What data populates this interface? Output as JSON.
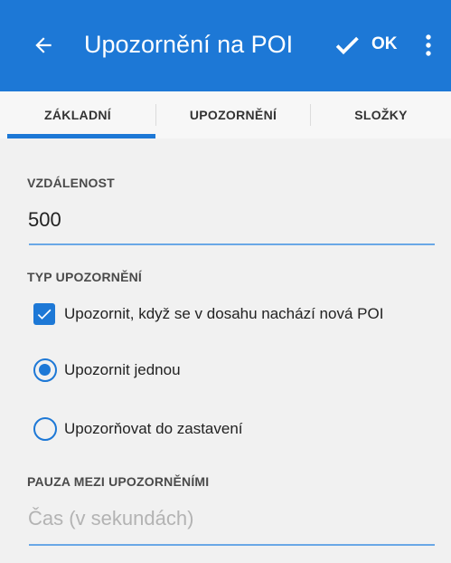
{
  "appbar": {
    "title": "Upozornění na POI",
    "ok_label": "OK",
    "icons": {
      "back": "arrow-left-icon",
      "confirm": "check-icon",
      "menu": "more-vertical-icon"
    }
  },
  "tabs": [
    {
      "label": "ZÁKLADNÍ",
      "selected": true
    },
    {
      "label": "UPOZORNĚNÍ",
      "selected": false
    },
    {
      "label": "SLOŽKY",
      "selected": false
    }
  ],
  "distance": {
    "label": "VZDÁLENOST",
    "value": "500"
  },
  "alert_type": {
    "label": "TYP UPOZORNĚNÍ",
    "checkbox_label": "Upozornit, když se v dosahu nachází nová POI",
    "checkbox_checked": true,
    "options": [
      {
        "label": "Upozornit jednou",
        "selected": true
      },
      {
        "label": "Upozorňovat do zastavení",
        "selected": false
      }
    ]
  },
  "pause": {
    "label": "PAUZA MEZI UPOZORNĚNÍMI",
    "placeholder": "Čas (v sekundách)"
  },
  "colors": {
    "primary": "#1d78d6",
    "background": "#f1f1f1",
    "underline": "#6aa8e6"
  }
}
